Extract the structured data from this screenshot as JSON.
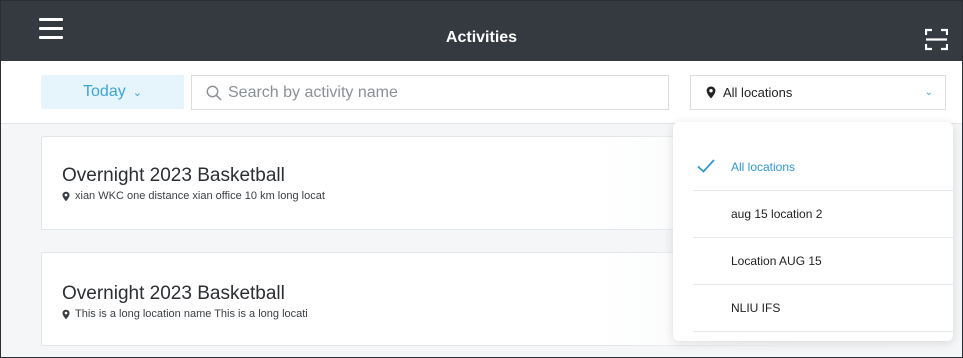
{
  "header": {
    "title": "Activities",
    "menu_icon": "hamburger-menu-icon",
    "scan_icon": "scan-frame-icon",
    "background": "#343a40"
  },
  "filters": {
    "date_label": "Today",
    "search_placeholder": "Search by activity name",
    "search_value": "",
    "location_selected": "All locations",
    "accent": "#3ea4d8"
  },
  "activities": [
    {
      "title": "Overnight 2023 Basketball",
      "location": "xian WKC one distance xian office 10 km long locat"
    },
    {
      "title": "Overnight 2023 Basketball",
      "location": "This is a long location name This is a long locati"
    }
  ],
  "location_dropdown": {
    "options": [
      {
        "label": "All locations",
        "selected": true
      },
      {
        "label": "aug 15 location 2",
        "selected": false
      },
      {
        "label": "Location AUG 15",
        "selected": false
      },
      {
        "label": "NLIU IFS",
        "selected": false
      }
    ]
  }
}
